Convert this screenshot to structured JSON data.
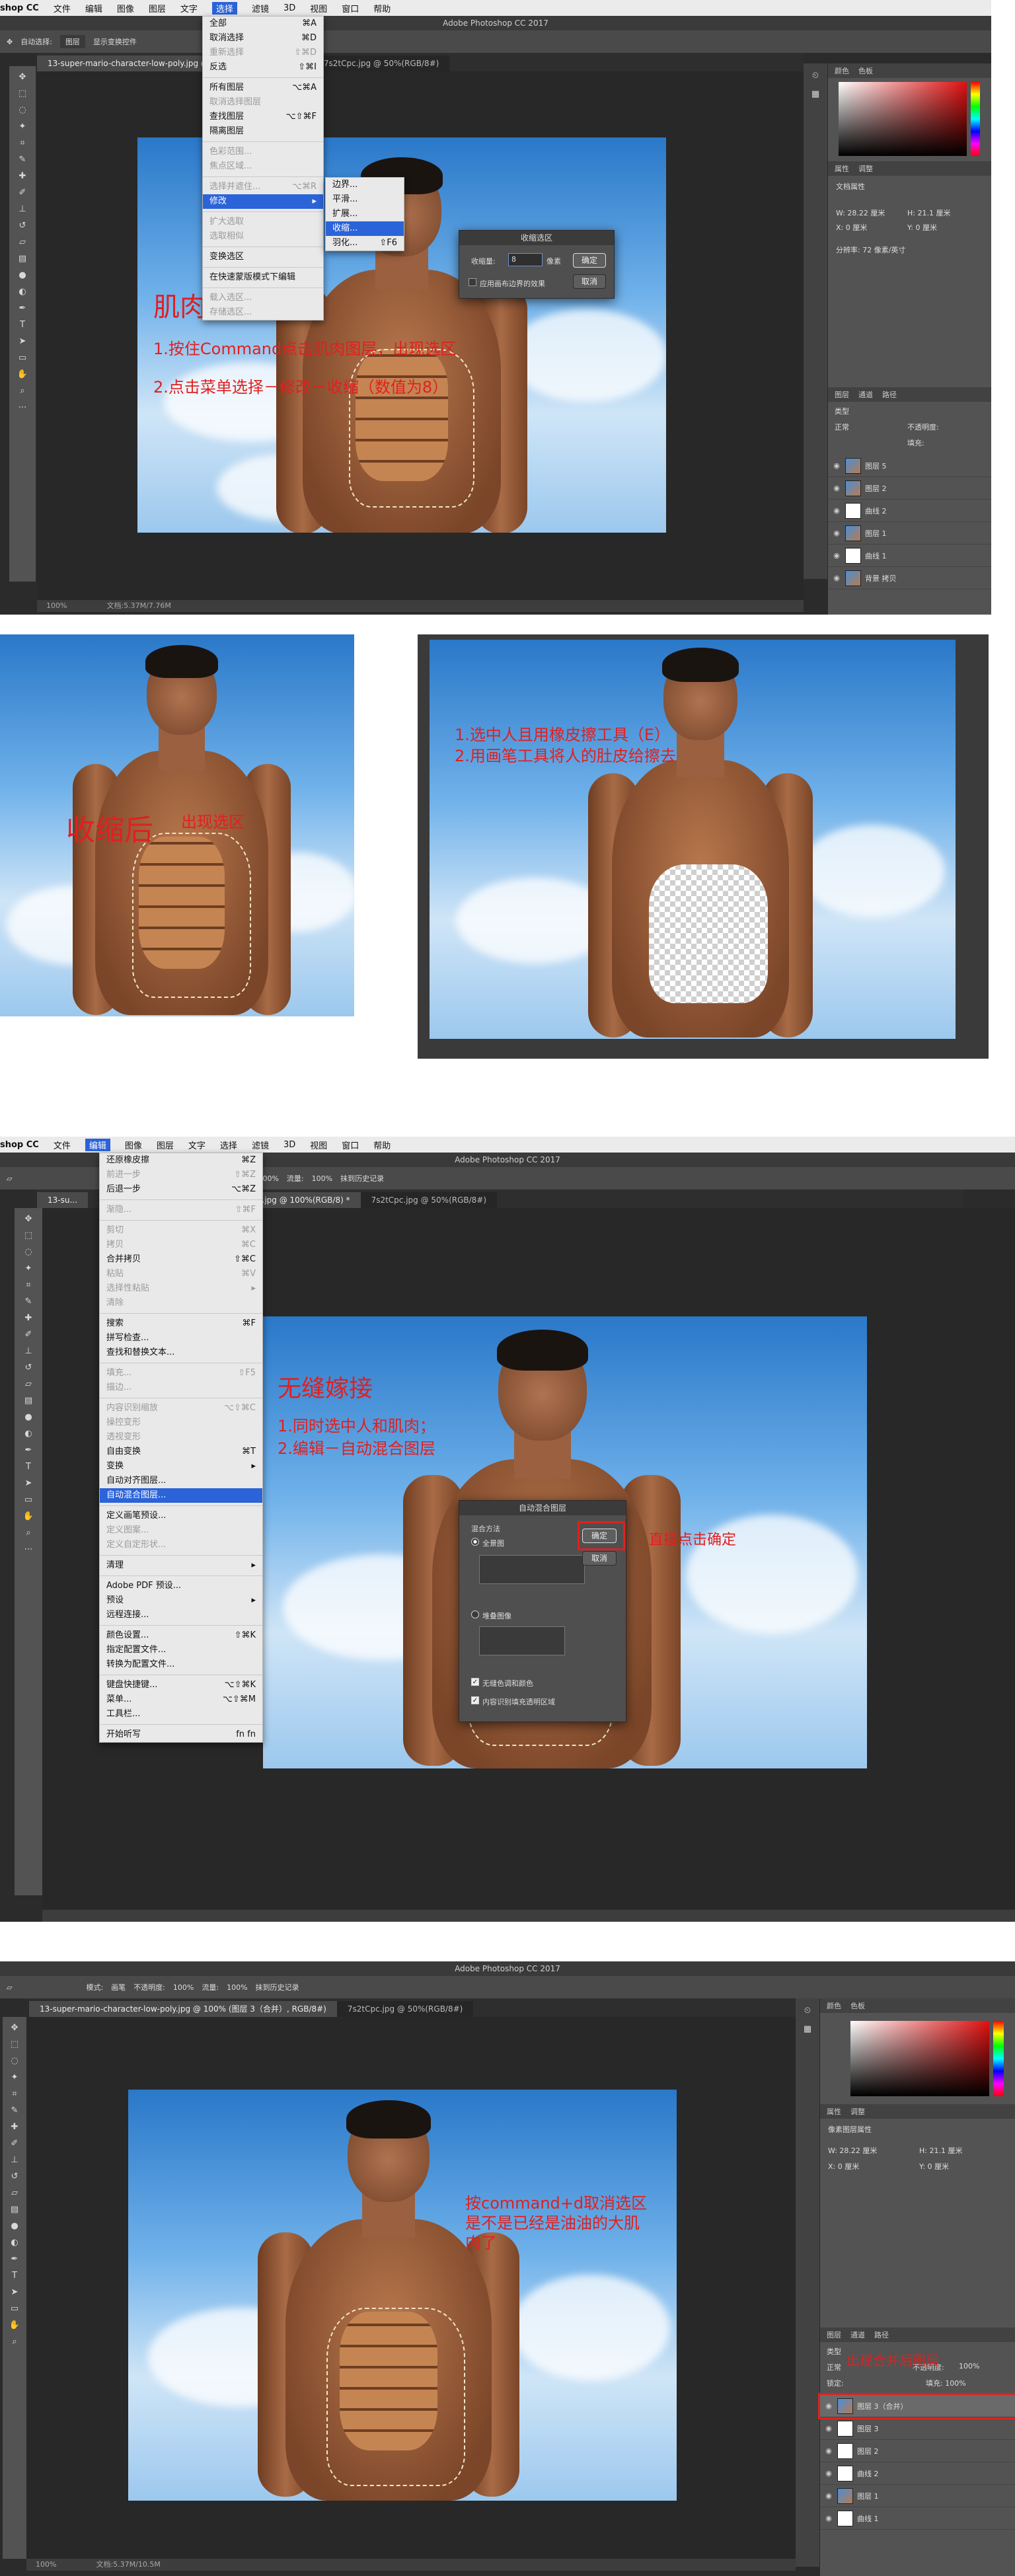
{
  "s1": {
    "menubar": [
      "shop CC",
      "文件",
      "编辑",
      "图像",
      "图层",
      "文字",
      "选择",
      "滤镜",
      "3D",
      "视图",
      "窗口",
      "帮助"
    ],
    "menubar_selected": "选择",
    "app_title": "Adobe Photoshop CC 2017",
    "options": {
      "auto_select": "自动选择:",
      "auto_value": "图层",
      "show_transform": "显示变换控件"
    },
    "tabs": [
      "13-super-mario-character-low-poly.jpg @ 100% (图层 3, RGB/8#)",
      "7s2tCpc.jpg @ 50%(RGB/8#)"
    ],
    "select_menu": [
      {
        "label": "全部",
        "key": "⌘A",
        "state": "normal"
      },
      {
        "label": "取消选择",
        "key": "⌘D",
        "state": "normal"
      },
      {
        "label": "重新选择",
        "key": "⇧⌘D",
        "state": "disabled"
      },
      {
        "label": "反选",
        "key": "⇧⌘I",
        "state": "normal"
      },
      {
        "sep": true
      },
      {
        "label": "所有图层",
        "key": "⌥⌘A",
        "state": "normal"
      },
      {
        "label": "取消选择图层",
        "key": "",
        "state": "disabled"
      },
      {
        "label": "查找图层",
        "key": "⌥⇧⌘F",
        "state": "normal"
      },
      {
        "label": "隔离图层",
        "key": "",
        "state": "normal"
      },
      {
        "sep": true
      },
      {
        "label": "色彩范围...",
        "key": "",
        "state": "disabled"
      },
      {
        "label": "焦点区域...",
        "key": "",
        "state": "disabled"
      },
      {
        "sep": true
      },
      {
        "label": "选择并遮住...",
        "key": "⌥⌘R",
        "state": "disabled"
      },
      {
        "label": "修改",
        "key": "▸",
        "state": "selected"
      },
      {
        "sep": true
      },
      {
        "label": "扩大选取",
        "key": "",
        "state": "disabled"
      },
      {
        "label": "选取相似",
        "key": "",
        "state": "disabled"
      },
      {
        "sep": true
      },
      {
        "label": "变换选区",
        "key": "",
        "state": "normal"
      },
      {
        "sep": true
      },
      {
        "label": "在快速蒙版模式下编辑",
        "key": "",
        "state": "normal"
      },
      {
        "sep": true
      },
      {
        "label": "载入选区...",
        "key": "",
        "state": "disabled"
      },
      {
        "label": "存储选区...",
        "key": "",
        "state": "disabled"
      }
    ],
    "modify_submenu": [
      {
        "label": "边界...",
        "key": "",
        "state": "normal"
      },
      {
        "label": "平滑...",
        "key": "",
        "state": "normal"
      },
      {
        "label": "扩展...",
        "key": "",
        "state": "normal"
      },
      {
        "label": "收缩...",
        "key": "",
        "state": "selected"
      },
      {
        "label": "羽化...",
        "key": "⇧F6",
        "state": "normal"
      }
    ],
    "dialog": {
      "title": "收缩选区",
      "field_label": "收缩量:",
      "value": "8",
      "unit": "像素",
      "checkbox": "应用画布边界的效果",
      "ok": "确定",
      "cancel": "取消"
    },
    "anno_title": "肌肉收缩",
    "anno_1": "1.按住Command点击肌肉图层，出现选区",
    "anno_2": "2.点击菜单选择－修改－收缩（数值为8）",
    "status": [
      "100%",
      "文档:5.37M/7.76M"
    ],
    "panels": {
      "color_tabs": [
        "颜色",
        "色板"
      ],
      "prop_tabs": [
        "属性",
        "调整"
      ],
      "prop_title": "文档属性",
      "w": "W: 28.22 厘米",
      "h": "H: 21.1 厘米",
      "x": "X: 0 厘米",
      "y": "Y: 0 厘米",
      "res": "分辨率: 72 像素/英寸",
      "layer_tabs": [
        "图层",
        "通道",
        "路径"
      ],
      "kind": "类型",
      "blend": "正常",
      "opacity": "不透明度:",
      "fill": "填充:"
    },
    "layers": [
      {
        "name": "图层 5",
        "mask": false
      },
      {
        "name": "图层 2",
        "mask": false
      },
      {
        "name": "曲线 2",
        "mask": true
      },
      {
        "name": "图层 1",
        "mask": false
      },
      {
        "name": "曲线 1",
        "mask": true
      },
      {
        "name": "背景 拷贝",
        "mask": false
      }
    ]
  },
  "s2": {
    "left_text_big": "收缩后",
    "left_text_small": "出现选区",
    "right_line1": "1.选中人且用橡皮擦工具（E）",
    "right_line2": "2.用画笔工具将人的肚皮给擦去"
  },
  "s3": {
    "menubar": [
      "shop CC",
      "文件",
      "编辑",
      "图像",
      "图层",
      "文字",
      "选择",
      "滤镜",
      "3D",
      "视图",
      "窗口",
      "帮助"
    ],
    "menubar_selected": "编辑",
    "app_title": "Adobe Photoshop CC 2017",
    "options": {
      "opacity": "100%",
      "flow": "流量:",
      "flow_value": "100%",
      "history": "抹到历史记录"
    },
    "tabs": [
      "13-su...",
      "...jpg @ 100%(RGB/8) *",
      "7s2tCpc.jpg @ 50%(RGB/8#)"
    ],
    "edit_menu": [
      {
        "label": "还原橡皮擦",
        "key": "⌘Z",
        "state": "normal"
      },
      {
        "label": "前进一步",
        "key": "⇧⌘Z",
        "state": "disabled"
      },
      {
        "label": "后退一步",
        "key": "⌥⌘Z",
        "state": "normal"
      },
      {
        "sep": true
      },
      {
        "label": "渐隐...",
        "key": "⇧⌘F",
        "state": "disabled"
      },
      {
        "sep": true
      },
      {
        "label": "剪切",
        "key": "⌘X",
        "state": "disabled"
      },
      {
        "label": "拷贝",
        "key": "⌘C",
        "state": "disabled"
      },
      {
        "label": "合并拷贝",
        "key": "⇧⌘C",
        "state": "normal"
      },
      {
        "label": "粘贴",
        "key": "⌘V",
        "state": "disabled"
      },
      {
        "label": "选择性粘贴",
        "key": "▸",
        "state": "disabled"
      },
      {
        "label": "清除",
        "key": "",
        "state": "disabled"
      },
      {
        "sep": true
      },
      {
        "label": "搜索",
        "key": "⌘F",
        "state": "normal"
      },
      {
        "label": "拼写检查...",
        "key": "",
        "state": "normal"
      },
      {
        "label": "查找和替换文本...",
        "key": "",
        "state": "normal"
      },
      {
        "sep": true
      },
      {
        "label": "填充...",
        "key": "⇧F5",
        "state": "disabled"
      },
      {
        "label": "描边...",
        "key": "",
        "state": "disabled"
      },
      {
        "sep": true
      },
      {
        "label": "内容识别缩放",
        "key": "⌥⇧⌘C",
        "state": "disabled"
      },
      {
        "label": "操控变形",
        "key": "",
        "state": "disabled"
      },
      {
        "label": "透视变形",
        "key": "",
        "state": "disabled"
      },
      {
        "label": "自由变换",
        "key": "⌘T",
        "state": "normal"
      },
      {
        "label": "变换",
        "key": "▸",
        "state": "normal"
      },
      {
        "label": "自动对齐图层...",
        "key": "",
        "state": "normal"
      },
      {
        "label": "自动混合图层...",
        "key": "",
        "state": "selected"
      },
      {
        "sep": true
      },
      {
        "label": "定义画笔预设...",
        "key": "",
        "state": "normal"
      },
      {
        "label": "定义图案...",
        "key": "",
        "state": "disabled"
      },
      {
        "label": "定义自定形状...",
        "key": "",
        "state": "disabled"
      },
      {
        "sep": true
      },
      {
        "label": "清理",
        "key": "▸",
        "state": "normal"
      },
      {
        "sep": true
      },
      {
        "label": "Adobe PDF 预设...",
        "key": "",
        "state": "normal"
      },
      {
        "label": "预设",
        "key": "▸",
        "state": "normal"
      },
      {
        "label": "远程连接...",
        "key": "",
        "state": "normal"
      },
      {
        "sep": true
      },
      {
        "label": "颜色设置...",
        "key": "⇧⌘K",
        "state": "normal"
      },
      {
        "label": "指定配置文件...",
        "key": "",
        "state": "normal"
      },
      {
        "label": "转换为配置文件...",
        "key": "",
        "state": "normal"
      },
      {
        "sep": true
      },
      {
        "label": "键盘快捷键...",
        "key": "⌥⇧⌘K",
        "state": "normal"
      },
      {
        "label": "菜单...",
        "key": "⌥⇧⌘M",
        "state": "normal"
      },
      {
        "label": "工具栏...",
        "key": "",
        "state": "normal"
      },
      {
        "sep": true
      },
      {
        "label": "开始听写",
        "key": "fn fn",
        "state": "normal"
      }
    ],
    "dialog": {
      "title": "自动混合图层",
      "method": "混合方法",
      "opt1": "全景图",
      "opt2": "堆叠图像",
      "chk1": "无缝色调和颜色",
      "chk2": "内容识别填充透明区域",
      "ok": "确定",
      "cancel": "取消"
    },
    "anno_title": "无缝嫁接",
    "anno_1": "1.同时选中人和肌肉；",
    "anno_2": "2.编辑－自动混合图层",
    "anno_ok": "直接点击确定"
  },
  "s4": {
    "app_title": "Adobe Photoshop CC 2017",
    "options": {
      "mode": "模式:",
      "mode_value": "画笔",
      "opacity": "不透明度:",
      "opacity_value": "100%",
      "flow": "流量:",
      "flow_value": "100%",
      "history": "抹到历史记录"
    },
    "tabs": [
      "13-super-mario-character-low-poly.jpg @ 100% (图层 3（合并）, RGB/8#)",
      "7s2tCpc.jpg @ 50%(RGB/8#)"
    ],
    "anno": [
      "按command+d取消选区",
      "是不是已经是油油的大肌",
      "肉了"
    ],
    "layers_note": "出现合并后图层",
    "panels": {
      "color_tabs": [
        "颜色",
        "色板"
      ],
      "prop_tabs": [
        "属性",
        "调整"
      ],
      "prop_title": "像素图层属性",
      "w": "W: 28.22 厘米",
      "h": "H: 21.1 厘米",
      "x": "X: 0 厘米",
      "y": "Y: 0 厘米",
      "layer_tabs": [
        "图层",
        "通道",
        "路径"
      ],
      "kind": "类型",
      "blend": "正常",
      "opacity_label": "不透明度:",
      "opacity": "100%",
      "lock": "锁定:",
      "fill": "填充: 100%"
    },
    "layers": [
      {
        "name": "图层 3（合并）",
        "mask": false,
        "highlight": true
      },
      {
        "name": "图层 3",
        "mask": true,
        "highlight": false
      },
      {
        "name": "图层 2",
        "mask": true,
        "highlight": false
      },
      {
        "name": "曲线 2",
        "mask": true,
        "highlight": false
      },
      {
        "name": "图层 1",
        "mask": false,
        "highlight": false
      },
      {
        "name": "曲线 1",
        "mask": true,
        "highlight": false
      }
    ],
    "status": [
      "100%",
      "文档:5.37M/10.5M"
    ]
  },
  "colors": {
    "accent": "#2b63d9",
    "annotation": "#e02020",
    "ps_dark": "#535353",
    "canvas": "#282828"
  }
}
